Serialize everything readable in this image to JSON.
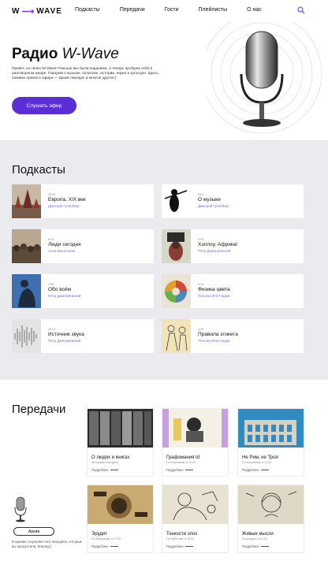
{
  "header": {
    "logo_left": "W",
    "logo_right": "WAVE",
    "nav": [
      "Подкасты",
      "Передачи",
      "Гости",
      "Плейлисты",
      "О нас"
    ]
  },
  "hero": {
    "title_bold": "Радио",
    "title_italic": "W-Wave",
    "text": "Привет, из своих W-Wave! Раньше мы были изданием, а теперь пробуем себя в разговорном жанре. Говорим о музыке, политике, истории, науке и культуре. Здесь, помимо прямого эфира — архив передач и многое другое:)",
    "button": "Слушать эфир"
  },
  "podcasts": {
    "title": "Подкасты",
    "items": [
      {
        "dur": "25:43",
        "name": "Европа, XIX век",
        "author": "Дмитрий Гутенберг"
      },
      {
        "dur": "5:52",
        "name": "О музыке",
        "author": "Дмитрий Гутенберг"
      },
      {
        "dur": "8:24",
        "name": "Люди сегодня",
        "author": "Анна Васильева"
      },
      {
        "dur": "9:04",
        "name": "Хэллоу, Африка!",
        "author": "Пётр Дмитриевский"
      },
      {
        "dur": "7:05",
        "name": "Обо всём",
        "author": "Пётр Дмитриевский"
      },
      {
        "dur": "9:23",
        "name": "Физика цвета",
        "author": "Татьяна Флетчадка"
      },
      {
        "dur": "26:02",
        "name": "Источник звука",
        "author": "Пётр Дмитриевский"
      },
      {
        "dur": "4:35",
        "name": "Правила этикета",
        "author": "Татьяна Флетчадка"
      }
    ]
  },
  "shows": {
    "title": "Передачи",
    "more_label": "Подробнее",
    "items": [
      {
        "name": "О людях и книгах",
        "date": "Авторская передача"
      },
      {
        "name": "Графомания td",
        "date": "По вторникам, в 10:00"
      },
      {
        "name": "Не Рим, не Троя",
        "date": "По вторникам, в 13:00"
      },
      {
        "name": "Эрудит",
        "date": "По вторникам, в 17:00"
      },
      {
        "name": "Тонкости эпох",
        "date": "По субботам, в 16:00"
      },
      {
        "name": "Живые мысли",
        "date": "По средам, в 10:00"
      }
    ],
    "archive_button": "Архив",
    "archive_text": "В архиве сохраняют все передачи, которые вы пропустили. Вперёд:)"
  },
  "colors": {
    "accent": "#5b2fd6",
    "section_bg": "#ebebef",
    "author": "#7a6fd0"
  }
}
